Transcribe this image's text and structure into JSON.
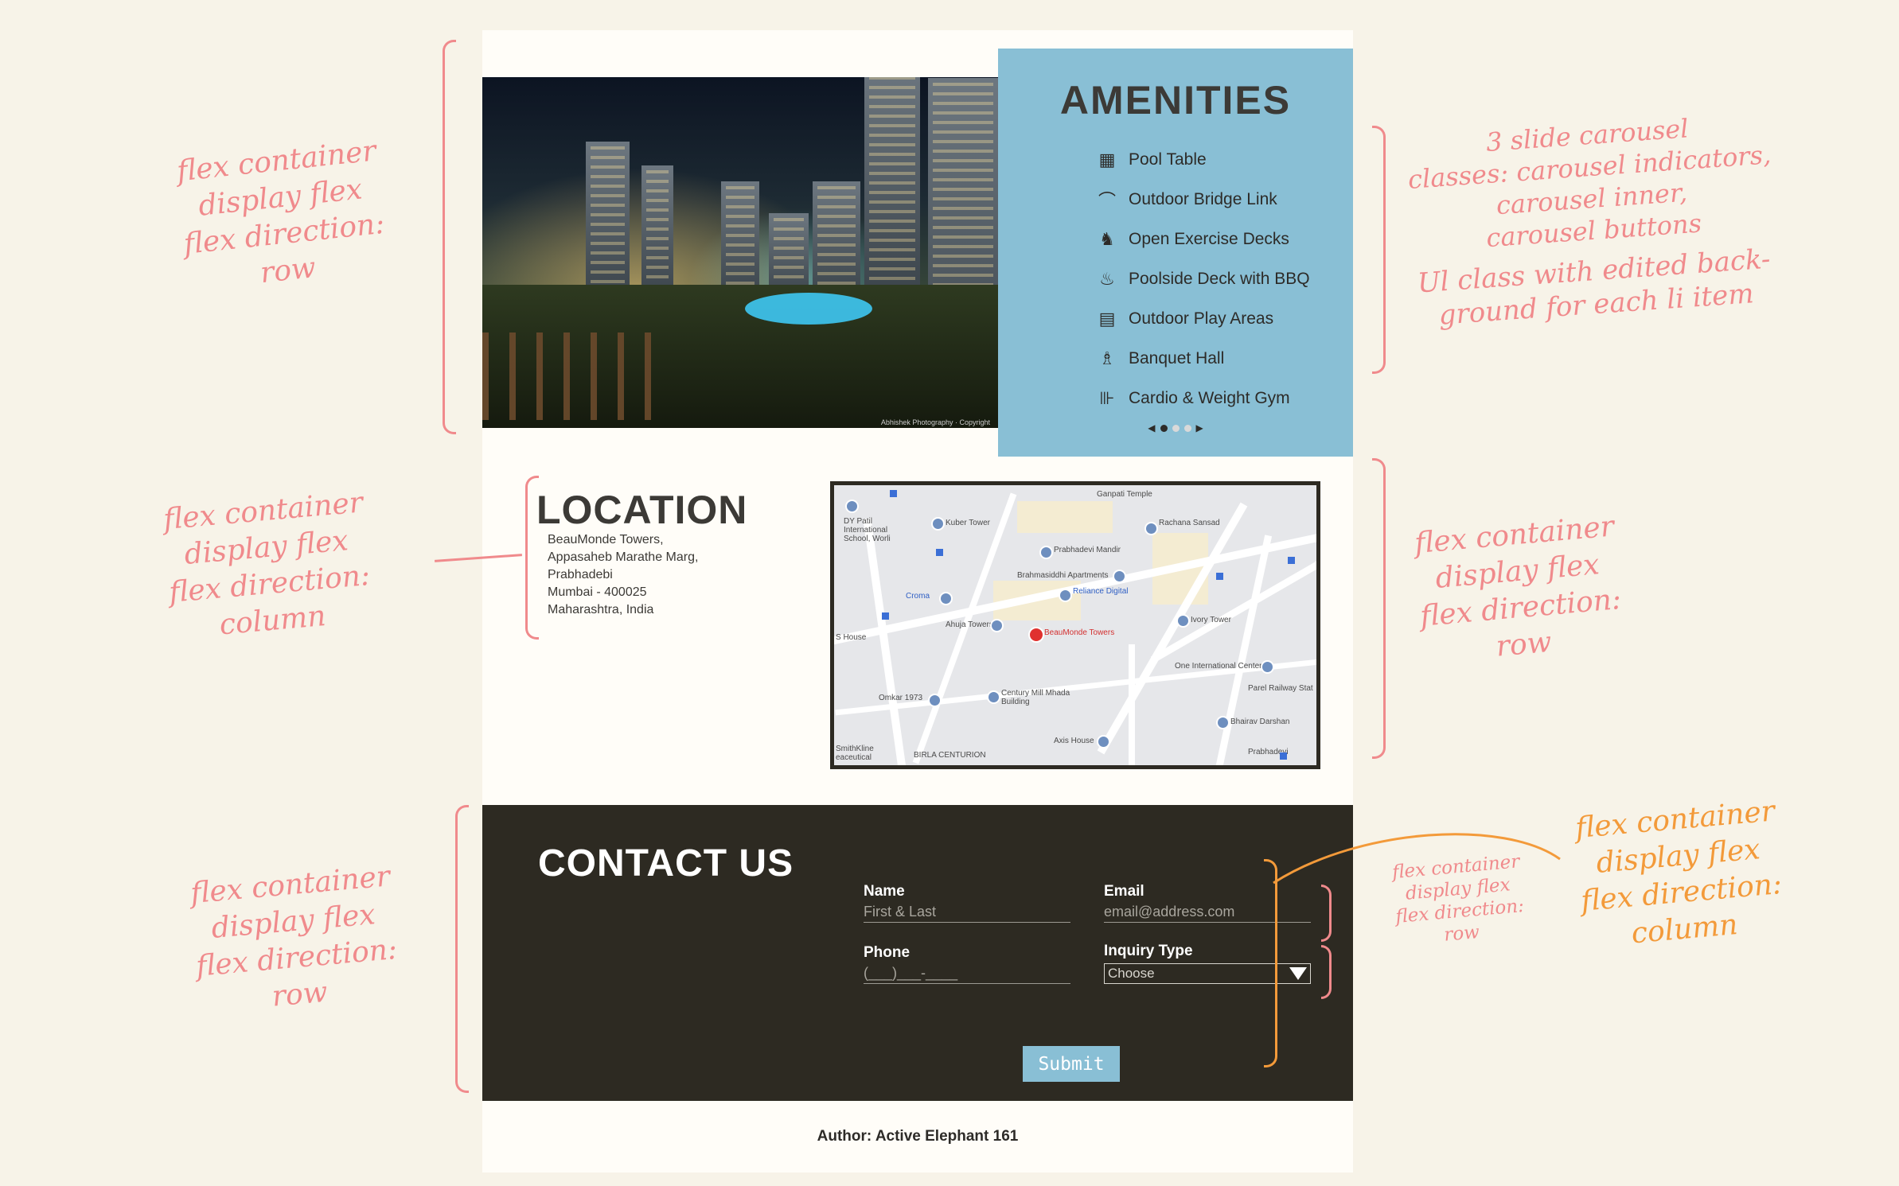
{
  "amenities": {
    "title": "AMENITIES",
    "items": [
      {
        "label": "Pool Table",
        "icon": "pool-table-icon",
        "glyph": "▦"
      },
      {
        "label": "Outdoor Bridge Link",
        "icon": "bridge-icon",
        "glyph": "⌒"
      },
      {
        "label": "Open Exercise Decks",
        "icon": "exercise-icon",
        "glyph": "♞"
      },
      {
        "label": "Poolside Deck with BBQ",
        "icon": "bbq-icon",
        "glyph": "♨"
      },
      {
        "label": "Outdoor Play Areas",
        "icon": "play-area-icon",
        "glyph": "▤"
      },
      {
        "label": "Banquet Hall",
        "icon": "banquet-icon",
        "glyph": "♗"
      },
      {
        "label": "Cardio & Weight Gym",
        "icon": "dumbbell-icon",
        "glyph": "⊪"
      }
    ],
    "carousel": {
      "prev": "◀",
      "next": "▶",
      "active_index": 0,
      "count": 3
    }
  },
  "photo": {
    "credit": "Abhishek Photography · Copyright"
  },
  "location": {
    "title": "LOCATION",
    "address_lines": [
      "BeauMonde Towers,",
      "Appasaheb Marathe Marg,",
      "Prabhadebi",
      "Mumbai - 400025",
      "Maharashtra, India"
    ],
    "map": {
      "marker_label": "BeauMonde Towers",
      "labels": [
        "Ganpati Temple",
        "DY Patil International School, Worli",
        "Kuber Tower",
        "Prabhadevi Mandir",
        "Rachana Sansad",
        "Brahmasiddhi Apartments",
        "Reliance Digital",
        "Croma",
        "Ahuja Towers",
        "Ivory Tower",
        "One International Center",
        "Parel Railway Stat",
        "Omkar 1973",
        "Century Mill Mhada Building",
        "Bhairav Darshan",
        "Axis House",
        "BIRLA CENTURION",
        "SmithKline eaceutical",
        "Prabhadevi",
        "S House"
      ]
    }
  },
  "contact": {
    "title": "CONTACT US",
    "name": {
      "label": "Name",
      "placeholder": "First & Last"
    },
    "email": {
      "label": "Email",
      "placeholder": "email@address.com"
    },
    "phone": {
      "label": "Phone",
      "placeholder": "(___)___-____"
    },
    "inquiry": {
      "label": "Inquiry Type",
      "selected": "Choose"
    },
    "submit_label": "Submit"
  },
  "footer": {
    "author": "Author: Active Elephant 161"
  },
  "annotations": {
    "hero_row": "flex container\ndisplay flex\nflex direction:\nrow",
    "carousel": "3 slide carousel\nclasses: carousel indicators,\ncarousel inner,\ncarousel buttons",
    "ul_class": "Ul class with edited back-\nground for each li item",
    "location_left": "flex container\ndisplay flex\nflex direction:\ncolumn",
    "location_right": "flex container\ndisplay flex\nflex direction:\nrow",
    "contact_left": "flex container\ndisplay flex\nflex direction:\nrow",
    "form_row": "flex container\ndisplay flex\nflex direction:\nrow",
    "form_column": "flex container\ndisplay flex\nflex direction:\ncolumn"
  }
}
